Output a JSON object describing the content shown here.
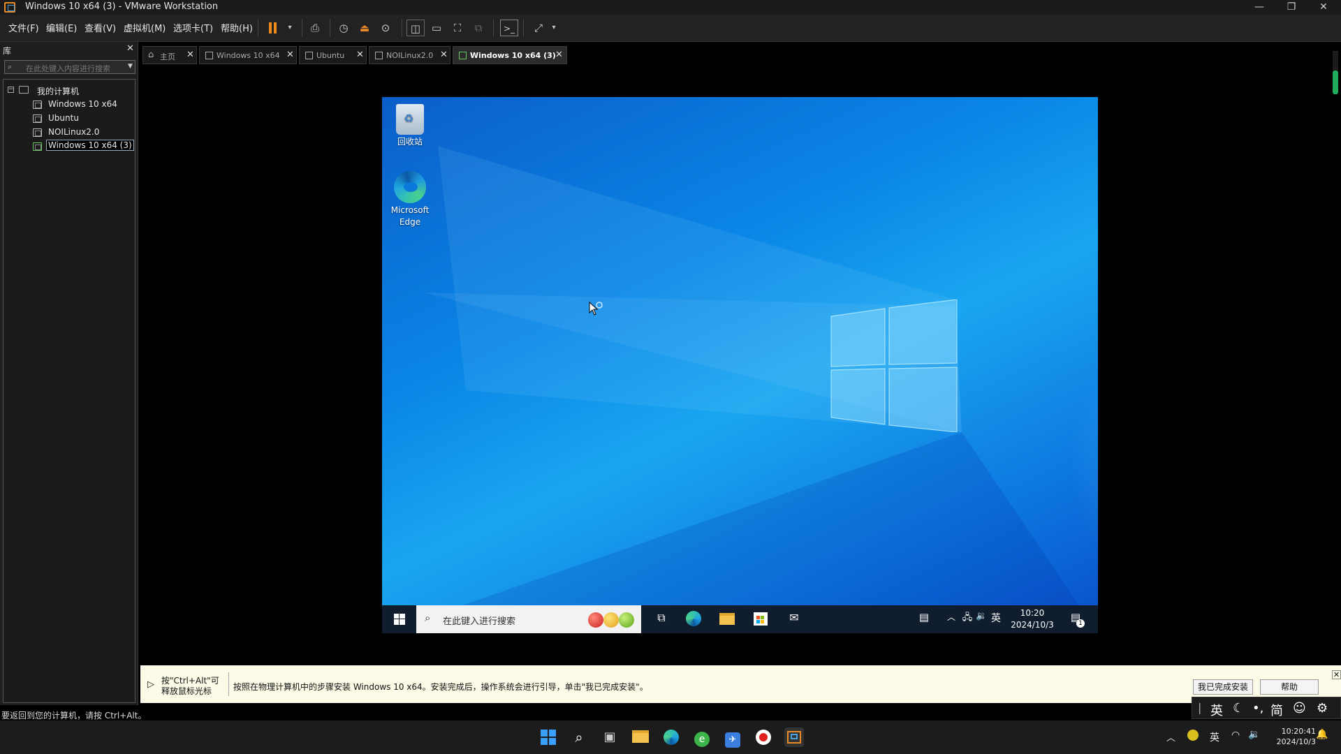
{
  "window": {
    "title": "Windows 10 x64 (3) - VMware Workstation"
  },
  "menu": [
    "文件(F)",
    "编辑(E)",
    "查看(V)",
    "虚拟机(M)",
    "选项卡(T)",
    "帮助(H)"
  ],
  "library": {
    "title": "库",
    "search_placeholder": "在此处键入内容进行搜索",
    "root": "我的计算机",
    "items": [
      "Windows 10 x64",
      "Ubuntu",
      "NOILinux2.0",
      "Windows 10 x64 (3)"
    ]
  },
  "tabs": [
    {
      "label": "主页"
    },
    {
      "label": "Windows 10 x64"
    },
    {
      "label": "Ubuntu"
    },
    {
      "label": "NOILinux2.0"
    },
    {
      "label": "Windows 10 x64 (3)",
      "active": true
    }
  ],
  "guest": {
    "desktop_icons": [
      {
        "label": "回收站",
        "icon": "recycle-bin-icon"
      },
      {
        "label": "Microsoft Edge",
        "icon": "edge-icon"
      }
    ],
    "taskbar": {
      "search_placeholder": "在此键入进行搜索",
      "ime": "英",
      "time": "10:20",
      "date": "2024/10/3",
      "notification_count": "1"
    }
  },
  "install_bar": {
    "tip": "按\"Ctrl+Alt\"可释放鼠标光标",
    "message": "按照在物理计算机中的步骤安装 Windows 10 x64。安装完成后，操作系统会进行引导，单击\"我已完成安装\"。",
    "done_button": "我已完成安装",
    "help_button": "帮助"
  },
  "status": "要返回到您的计算机，请按 Ctrl+Alt。",
  "ime_bar": {
    "lang": "英",
    "mode": "简"
  },
  "host_taskbar": {
    "ime": "英",
    "time": "10:20:41",
    "date": "2024/10/3"
  },
  "colors": {
    "accent": "#ef8a1f",
    "guest_blue": "#0a86e6",
    "install_bar_bg": "#fbfbe8"
  }
}
